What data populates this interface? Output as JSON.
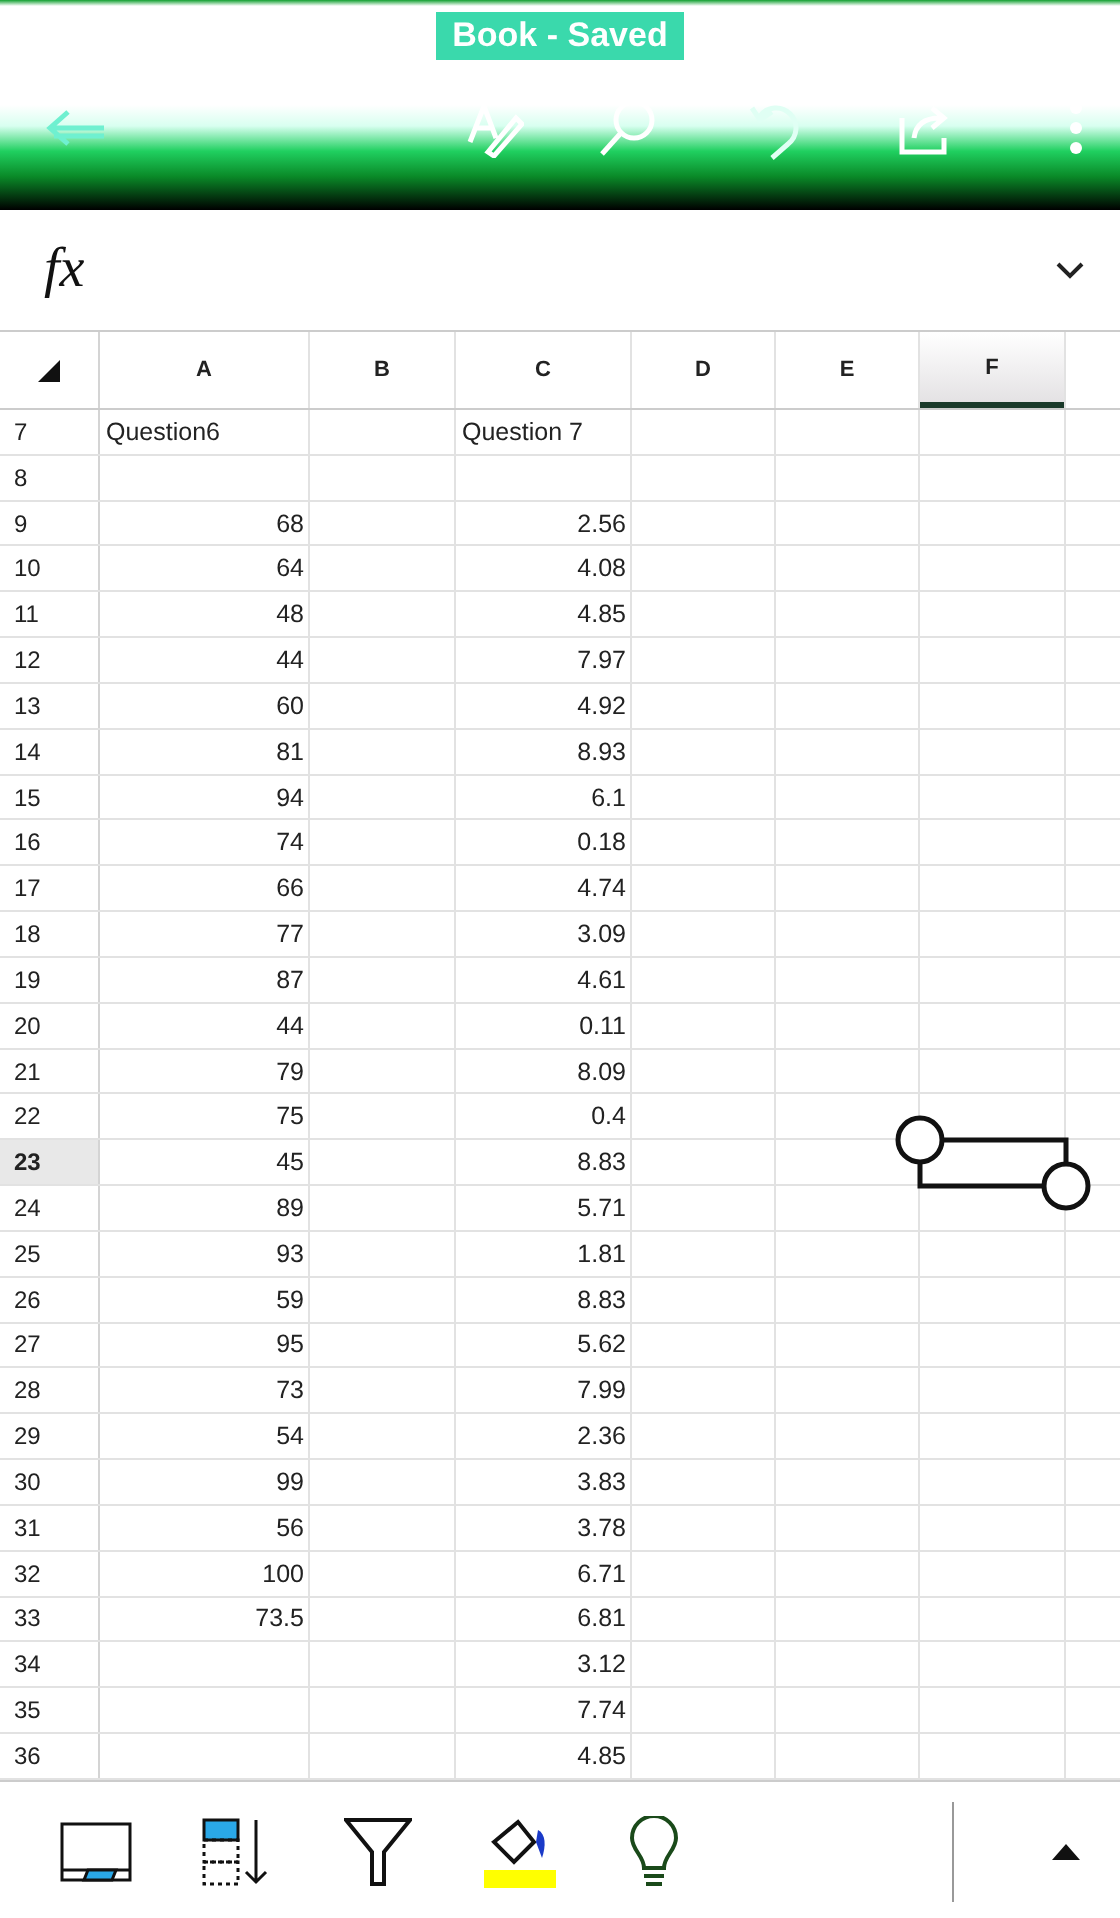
{
  "window": {
    "title": "Book - Saved"
  },
  "formula_bar": {
    "label": "fx"
  },
  "columns": [
    {
      "label": "A",
      "selected": false
    },
    {
      "label": "B",
      "selected": false
    },
    {
      "label": "C",
      "selected": false
    },
    {
      "label": "D",
      "selected": false
    },
    {
      "label": "E",
      "selected": false
    },
    {
      "label": "F",
      "selected": true
    }
  ],
  "rows": [
    {
      "row": "7",
      "kind": "label",
      "selected": false,
      "cells": [
        "Question6",
        null,
        "Question 7"
      ]
    },
    {
      "row": "8",
      "kind": "number",
      "selected": false,
      "cells": []
    },
    {
      "row": "9",
      "kind": "number",
      "selected": false,
      "cells": [
        "68",
        null,
        "2.56"
      ]
    },
    {
      "row": "10",
      "kind": "number",
      "selected": false,
      "cells": [
        "64",
        null,
        "4.08"
      ]
    },
    {
      "row": "11",
      "kind": "number",
      "selected": false,
      "cells": [
        "48",
        null,
        "4.85"
      ]
    },
    {
      "row": "12",
      "kind": "number",
      "selected": false,
      "cells": [
        "44",
        null,
        "7.97"
      ]
    },
    {
      "row": "13",
      "kind": "number",
      "selected": false,
      "cells": [
        "60",
        null,
        "4.92"
      ]
    },
    {
      "row": "14",
      "kind": "number",
      "selected": false,
      "cells": [
        "81",
        null,
        "8.93"
      ]
    },
    {
      "row": "15",
      "kind": "number",
      "selected": false,
      "cells": [
        "94",
        null,
        "6.1"
      ]
    },
    {
      "row": "16",
      "kind": "number",
      "selected": false,
      "cells": [
        "74",
        null,
        "0.18"
      ]
    },
    {
      "row": "17",
      "kind": "number",
      "selected": false,
      "cells": [
        "66",
        null,
        "4.74"
      ]
    },
    {
      "row": "18",
      "kind": "number",
      "selected": false,
      "cells": [
        "77",
        null,
        "3.09"
      ]
    },
    {
      "row": "19",
      "kind": "number",
      "selected": false,
      "cells": [
        "87",
        null,
        "4.61"
      ]
    },
    {
      "row": "20",
      "kind": "number",
      "selected": false,
      "cells": [
        "44",
        null,
        "0.11"
      ]
    },
    {
      "row": "21",
      "kind": "number",
      "selected": false,
      "cells": [
        "79",
        null,
        "8.09"
      ]
    },
    {
      "row": "22",
      "kind": "number",
      "selected": false,
      "cells": [
        "75",
        null,
        "0.4"
      ]
    },
    {
      "row": "23",
      "kind": "number",
      "selected": true,
      "cells": [
        "45",
        null,
        "8.83"
      ]
    },
    {
      "row": "24",
      "kind": "number",
      "selected": false,
      "cells": [
        "89",
        null,
        "5.71"
      ]
    },
    {
      "row": "25",
      "kind": "number",
      "selected": false,
      "cells": [
        "93",
        null,
        "1.81"
      ]
    },
    {
      "row": "26",
      "kind": "number",
      "selected": false,
      "cells": [
        "59",
        null,
        "8.83"
      ]
    },
    {
      "row": "27",
      "kind": "number",
      "selected": false,
      "cells": [
        "95",
        null,
        "5.62"
      ]
    },
    {
      "row": "28",
      "kind": "number",
      "selected": false,
      "cells": [
        "73",
        null,
        "7.99"
      ]
    },
    {
      "row": "29",
      "kind": "number",
      "selected": false,
      "cells": [
        "54",
        null,
        "2.36"
      ]
    },
    {
      "row": "30",
      "kind": "number",
      "selected": false,
      "cells": [
        "99",
        null,
        "3.83"
      ]
    },
    {
      "row": "31",
      "kind": "number",
      "selected": false,
      "cells": [
        "56",
        null,
        "3.78"
      ]
    },
    {
      "row": "32",
      "kind": "number",
      "selected": false,
      "cells": [
        "100",
        null,
        "6.71"
      ]
    },
    {
      "row": "33",
      "kind": "number",
      "selected": false,
      "cells": [
        "73.5",
        null,
        "6.81"
      ]
    },
    {
      "row": "34",
      "kind": "number",
      "selected": false,
      "cells": [
        null,
        null,
        "3.12"
      ]
    },
    {
      "row": "35",
      "kind": "number",
      "selected": false,
      "cells": [
        null,
        null,
        "7.74"
      ]
    },
    {
      "row": "36",
      "kind": "number",
      "selected": false,
      "cells": [
        null,
        null,
        "4.85"
      ]
    }
  ]
}
